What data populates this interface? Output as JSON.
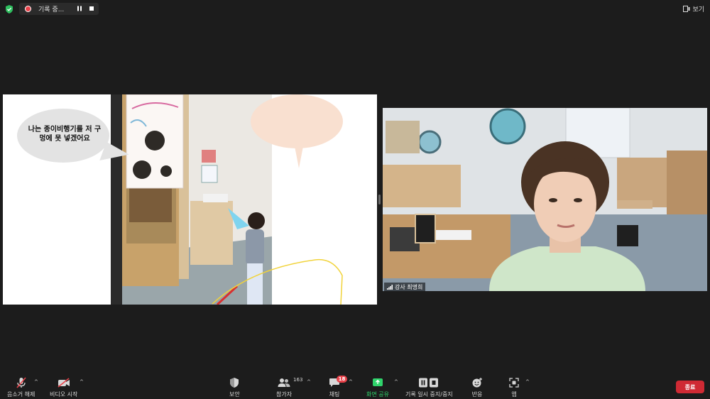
{
  "topbar": {
    "recording_label": "기록 중...",
    "view_label": "보기"
  },
  "share": {
    "bubble_text": "나는 종이비행기를 저 구멍에 못 넣겠어요"
  },
  "video": {
    "participant_name": "강사 최명희"
  },
  "toolbar": {
    "mute_label": "음소거 해제",
    "video_label": "비디오 시작",
    "security_label": "보안",
    "participants_label": "참가자",
    "participants_count": "163",
    "chat_label": "채팅",
    "chat_badge": "18",
    "share_label": "화면 공유",
    "record_label": "기록 일시 중지/중지",
    "reactions_label": "반응",
    "apps_label": "앱",
    "end_label": "종료"
  },
  "colors": {
    "background": "#1c1c1c",
    "share_green": "#2fd36b",
    "end_red": "#cf2a34",
    "badge_red": "#e8424a"
  }
}
